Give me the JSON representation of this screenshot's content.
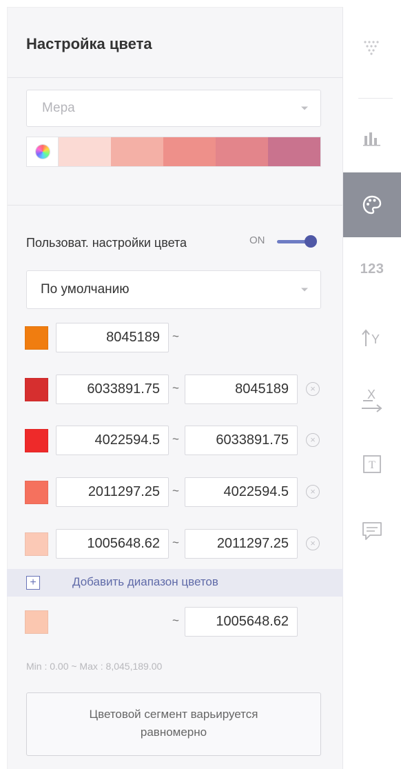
{
  "panel": {
    "title": "Настройка цвета",
    "measure_select": {
      "placeholder": "Мера"
    },
    "palette_colors": [
      "#fbdad4",
      "#f4b0a6",
      "#ee908a",
      "#e3858b",
      "#c9738e"
    ],
    "custom_colors": {
      "label": "Пользоват. настройки цвета",
      "toggle_state": "ON",
      "enabled": true
    },
    "preset_select": {
      "value": "По умолчанию"
    },
    "ranges": [
      {
        "color": "#f07d10",
        "from": "8045189",
        "to": "",
        "removable": false
      },
      {
        "color": "#d62f2f",
        "from": "6033891.75",
        "to": "8045189",
        "removable": true
      },
      {
        "color": "#ee2a2a",
        "from": "4022594.5",
        "to": "6033891.75",
        "removable": true
      },
      {
        "color": "#f5715e",
        "from": "2011297.25",
        "to": "4022594.5",
        "removable": true
      },
      {
        "color": "#fbc9b6",
        "from": "1005648.62",
        "to": "2011297.25",
        "removable": true
      }
    ],
    "add_range_label": "Добавить диапазон цветов",
    "bottom_range": {
      "color": "#fbc7b0",
      "from": "",
      "to": "1005648.62"
    },
    "tilde": "~",
    "minmax_text": "Min : 0.00 ~ Max : 8,045,189.00",
    "segment_button": {
      "line1": "Цветовой сегмент варьируется",
      "line2": "равномерно"
    }
  },
  "toolbar": {
    "items": [
      {
        "name": "dots",
        "icon": "dots-triangle-icon",
        "active": false
      },
      {
        "name": "chart",
        "icon": "bar-chart-icon",
        "active": false
      },
      {
        "name": "color",
        "icon": "palette-icon",
        "active": true
      },
      {
        "name": "number",
        "icon": "number-format-icon",
        "label": "123",
        "active": false
      },
      {
        "name": "y-axis",
        "icon": "y-axis-icon",
        "label": "Y",
        "active": false
      },
      {
        "name": "x-axis",
        "icon": "x-axis-icon",
        "label": "X",
        "active": false
      },
      {
        "name": "text",
        "icon": "text-box-icon",
        "label": "T",
        "active": false
      },
      {
        "name": "comment",
        "icon": "comment-icon",
        "active": false
      }
    ]
  }
}
